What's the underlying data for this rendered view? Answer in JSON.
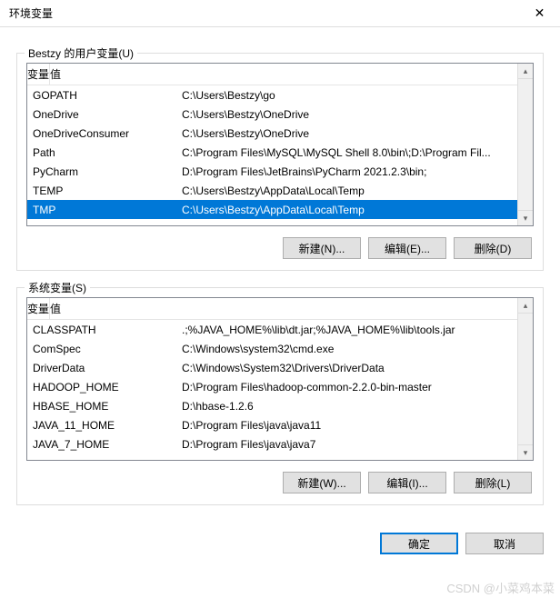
{
  "window": {
    "title": "环境变量",
    "close_glyph": "✕"
  },
  "user_section": {
    "legend": "Bestzy 的用户变量(U)",
    "header_name": "变量",
    "header_value": "值",
    "rows": [
      {
        "name": "GOPATH",
        "value": "C:\\Users\\Bestzy\\go"
      },
      {
        "name": "OneDrive",
        "value": "C:\\Users\\Bestzy\\OneDrive"
      },
      {
        "name": "OneDriveConsumer",
        "value": "C:\\Users\\Bestzy\\OneDrive"
      },
      {
        "name": "Path",
        "value": "C:\\Program Files\\MySQL\\MySQL Shell 8.0\\bin\\;D:\\Program Fil..."
      },
      {
        "name": "PyCharm",
        "value": "D:\\Program Files\\JetBrains\\PyCharm 2021.2.3\\bin;"
      },
      {
        "name": "TEMP",
        "value": "C:\\Users\\Bestzy\\AppData\\Local\\Temp"
      },
      {
        "name": "TMP",
        "value": "C:\\Users\\Bestzy\\AppData\\Local\\Temp"
      }
    ],
    "selected_index": 6,
    "buttons": {
      "new": "新建(N)...",
      "edit": "编辑(E)...",
      "delete": "删除(D)"
    }
  },
  "system_section": {
    "legend": "系统变量(S)",
    "header_name": "变量",
    "header_value": "值",
    "rows": [
      {
        "name": "CLASSPATH",
        "value": ".;%JAVA_HOME%\\lib\\dt.jar;%JAVA_HOME%\\lib\\tools.jar"
      },
      {
        "name": "ComSpec",
        "value": "C:\\Windows\\system32\\cmd.exe"
      },
      {
        "name": "DriverData",
        "value": "C:\\Windows\\System32\\Drivers\\DriverData"
      },
      {
        "name": "HADOOP_HOME",
        "value": "D:\\Program Files\\hadoop-common-2.2.0-bin-master"
      },
      {
        "name": "HBASE_HOME",
        "value": "D:\\hbase-1.2.6"
      },
      {
        "name": "JAVA_11_HOME",
        "value": "D:\\Program Files\\java\\java11"
      },
      {
        "name": "JAVA_7_HOME",
        "value": "D:\\Program Files\\java\\java7"
      }
    ],
    "selected_index": -1,
    "buttons": {
      "new": "新建(W)...",
      "edit": "编辑(I)...",
      "delete": "删除(L)"
    }
  },
  "dialog_buttons": {
    "ok": "确定",
    "cancel": "取消"
  },
  "watermark": "CSDN @小菜鸡本菜"
}
